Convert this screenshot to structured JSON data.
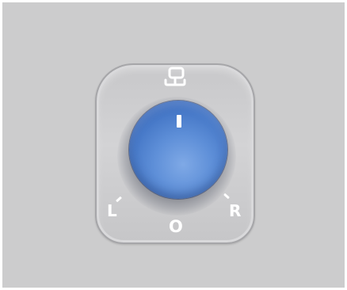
{
  "mirror_switch": {
    "icon": "mirror-adjust-icon",
    "knob_mark": "I",
    "positions": {
      "left": "L",
      "off": "O",
      "right": "R"
    },
    "colors": {
      "background": "#cccccd",
      "panel": "#cfcfd1",
      "knob": "#5e8fd8",
      "marking": "#ffffff"
    }
  }
}
